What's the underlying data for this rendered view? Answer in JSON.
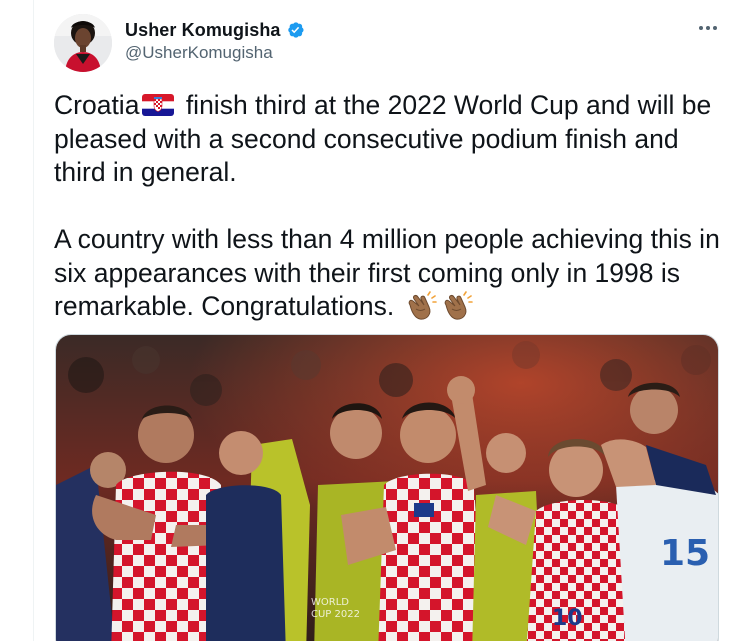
{
  "author": {
    "display_name": "Usher Komugisha",
    "handle": "@UsherKomugisha",
    "verified": true,
    "avatar": "profile-photo"
  },
  "tweet": {
    "line1_before_flag": "Croatia",
    "flag_icon": "croatia-flag-icon",
    "line1_after_flag": "finish third at the 2022 World Cup and will be pleased with a second consecutive podium finish and third in general.",
    "paragraph2": "A country with less than 4 million people achieving this in six appearances with their first coming only in 1998 is remarkable. Congratulations.",
    "clap_icons": [
      "clapping-hands-icon",
      "clapping-hands-icon"
    ]
  },
  "media": {
    "type": "photo",
    "subject": "croatia-players-applauding",
    "visible_text": {
      "shirt_number": "10",
      "bib_number": "15",
      "board_text": "WORLD CUP 2022"
    }
  },
  "colors": {
    "text_primary": "#0f1419",
    "text_secondary": "#536471",
    "verified_blue": "#1d9bf0",
    "croatia_red": "#d7182a",
    "divider": "#eff3f4"
  }
}
